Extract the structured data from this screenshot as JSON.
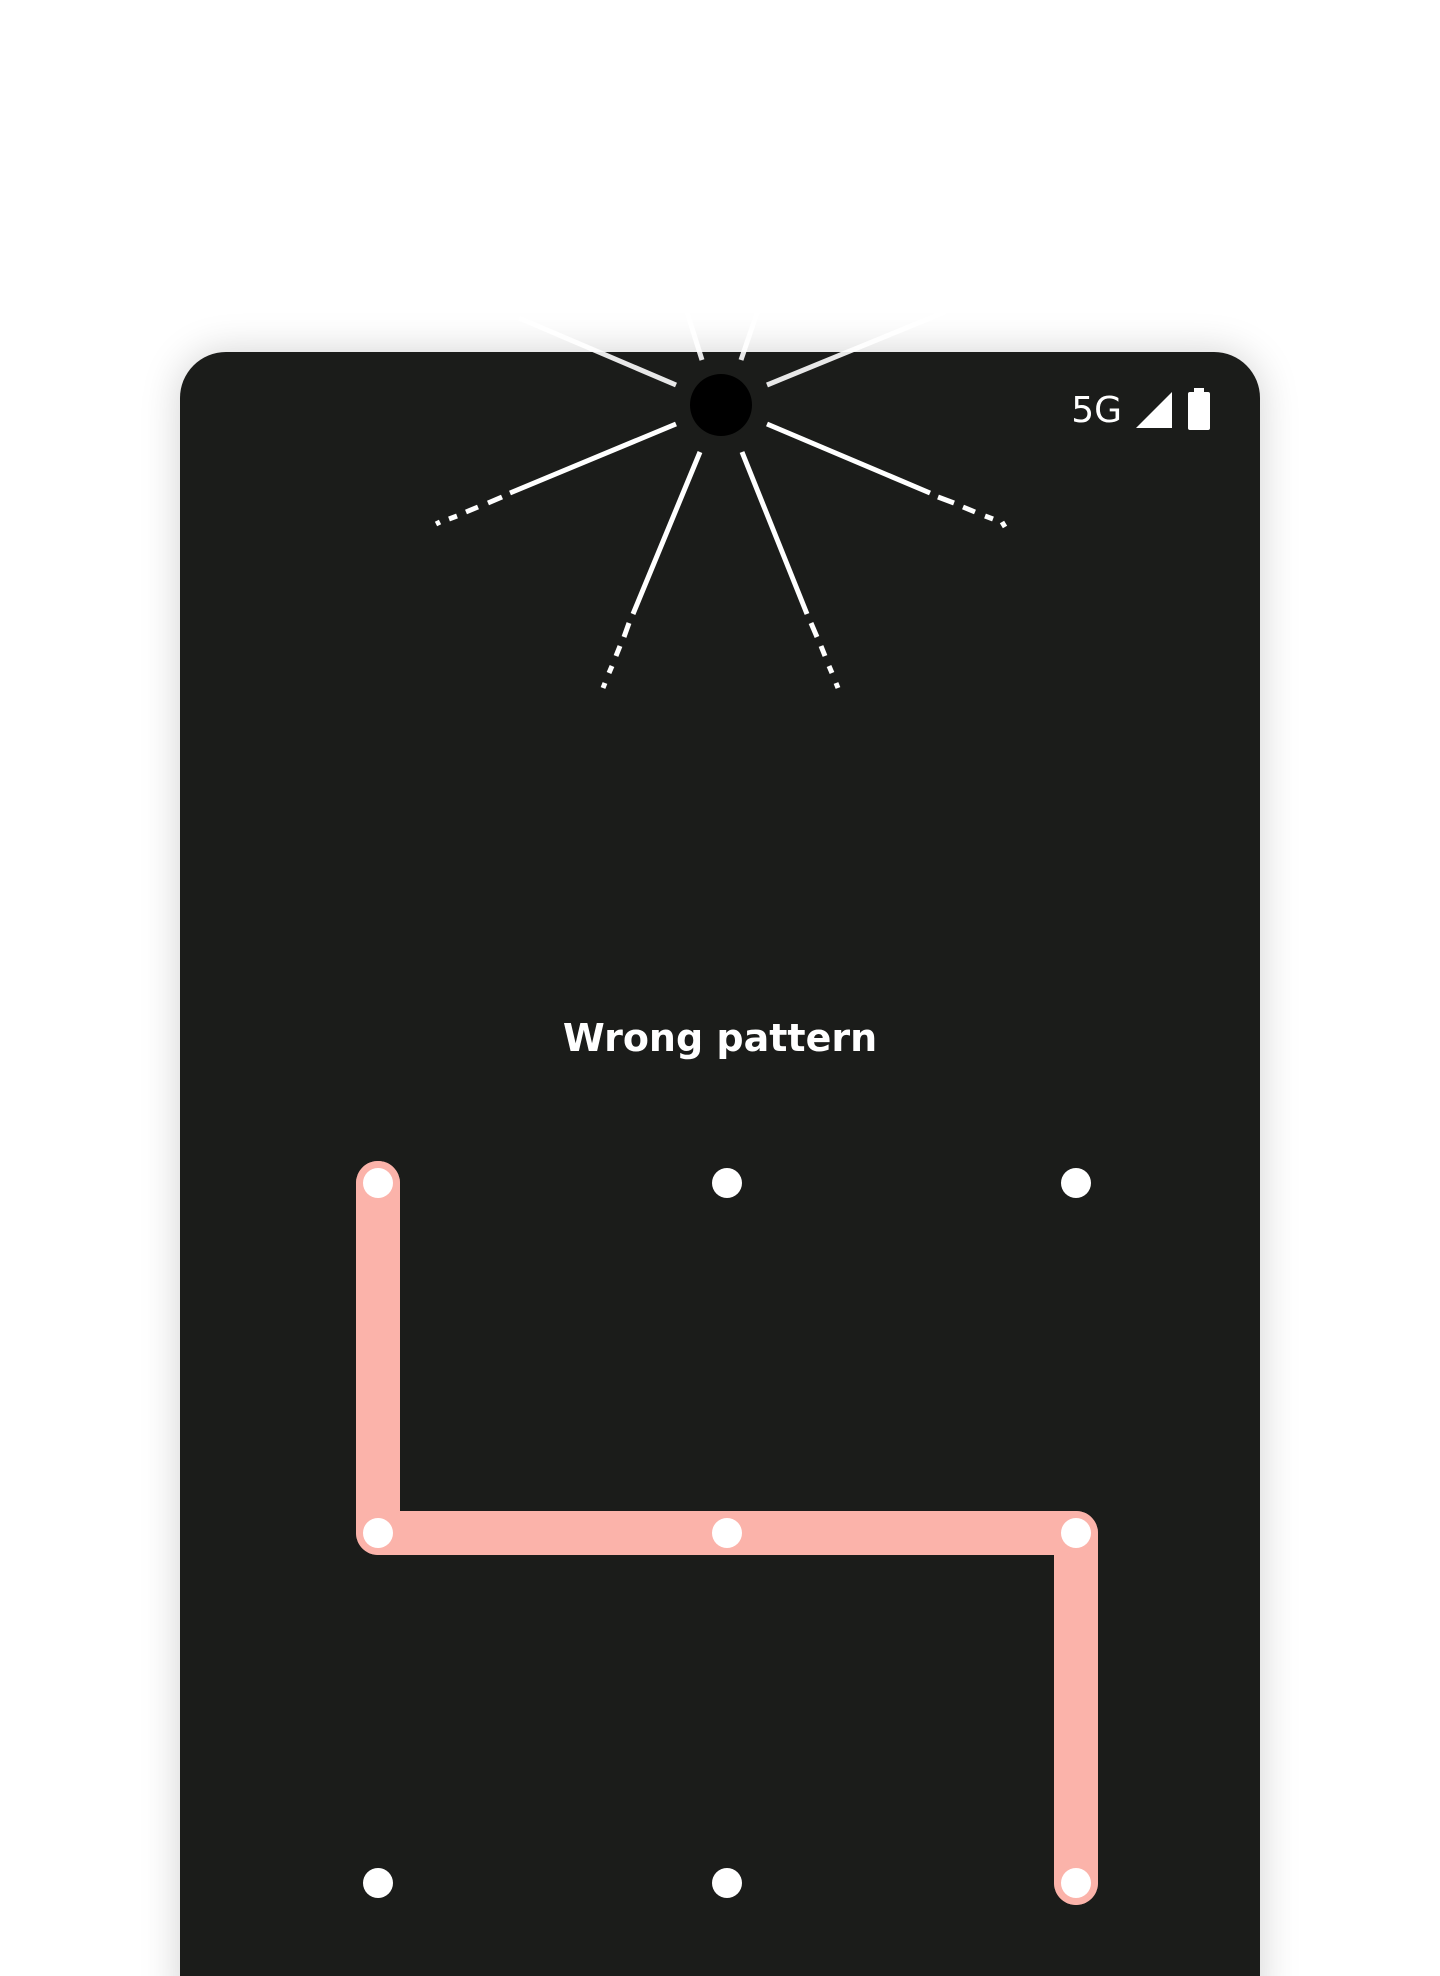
{
  "status_bar": {
    "network": "5G",
    "signal_icon": "cell-signal-icon",
    "battery_icon": "battery-full-icon"
  },
  "lock_screen": {
    "message": "Wrong pattern",
    "camera_icon": "front-camera-icon"
  },
  "pattern": {
    "grid_rows": 3,
    "grid_cols": 3,
    "selected_path": [
      0,
      3,
      4,
      5,
      8
    ],
    "error_color": "#fbb3aa",
    "dot_color": "#ffffff",
    "background_color": "#1b1c1a"
  }
}
